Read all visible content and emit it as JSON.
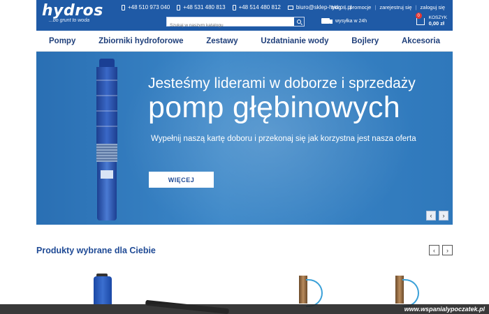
{
  "brand": {
    "name": "hydros",
    "tagline": "...bo grunt to woda"
  },
  "contacts": [
    {
      "type": "phone",
      "text": "+48 510 973 040"
    },
    {
      "type": "phone",
      "text": "+48 531 480 813"
    },
    {
      "type": "phone",
      "text": "+48 514 480 812"
    },
    {
      "type": "mail",
      "text": "biuro@sklep-hydros.pl"
    }
  ],
  "toplinks": [
    "blog",
    "promocje",
    "zarejestruj się",
    "zaloguj się"
  ],
  "search": {
    "placeholder": "Szukaj w naszym katalogu"
  },
  "shipping": {
    "text": "wysyłka w 24h"
  },
  "cart": {
    "count": "0",
    "label": "KOSZYK",
    "total": "0,00 zł"
  },
  "nav": [
    "Pompy",
    "Zbiorniki hydroforowe",
    "Zestawy",
    "Uzdatnianie wody",
    "Bojlery",
    "Akcesoria"
  ],
  "hero": {
    "line1": "Jesteśmy liderami w doborze i sprzedaży",
    "line2": "pomp głębinowych",
    "subtitle": "Wypełnij naszą kartę doboru i przekonaj się jak korzystna jest nasza oferta",
    "button": "WIĘCEJ",
    "prev": "‹",
    "next": "›"
  },
  "products": {
    "title": "Produkty wybrane dla Ciebie",
    "prev": "‹",
    "next": "›"
  },
  "watermark": "www.wspanialypoczatek.pl"
}
